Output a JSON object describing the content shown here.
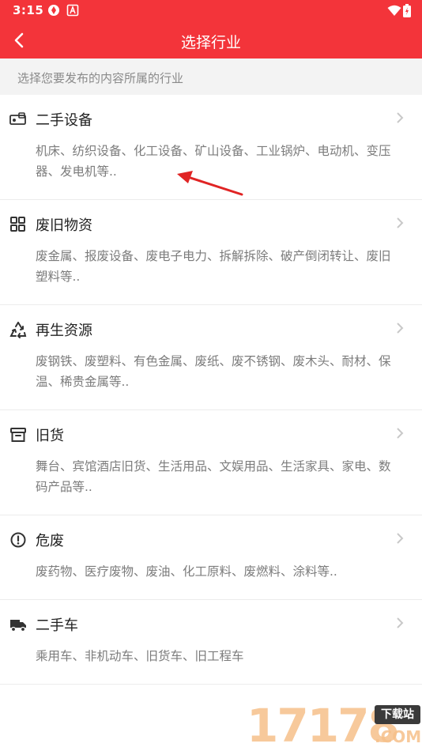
{
  "status_bar": {
    "time": "3:15",
    "icons": [
      "shield-icon",
      "a-box-icon",
      "wifi-icon",
      "battery-icon"
    ]
  },
  "app_bar": {
    "title": "选择行业",
    "back_icon": "chevron-left-icon"
  },
  "hint": "选择您要发布的内容所属的行业",
  "categories": [
    {
      "title": "二手设备",
      "icon": "equipment-icon",
      "desc": "机床、纺织设备、化工设备、矿山设备、工业锅炉、电动机、变压器、发电机等.."
    },
    {
      "title": "废旧物资",
      "icon": "grid-icon",
      "desc": "废金属、报废设备、废电子电力、拆解拆除、破产倒闭转让、废旧塑料等.."
    },
    {
      "title": "再生资源",
      "icon": "recycle-icon",
      "desc": "废钢铁、废塑料、有色金属、废纸、废不锈钢、废木头、耐材、保温、稀贵金属等.."
    },
    {
      "title": "旧货",
      "icon": "archive-icon",
      "desc": "舞台、宾馆酒店旧货、生活用品、文娱用品、生活家具、家电、数码产品等.."
    },
    {
      "title": "危废",
      "icon": "alert-circle-icon",
      "desc": "废药物、医疗废物、废油、化工原料、废燃料、涂料等.."
    },
    {
      "title": "二手车",
      "icon": "truck-icon",
      "desc": "乘用车、非机动车、旧货车、旧工程车"
    }
  ],
  "colors": {
    "header_bg": "#f3343a",
    "hint_bg": "#f3f3f3",
    "annotation_arrow": "#e02424"
  },
  "watermark": {
    "digits": "17178",
    "badge": "下载站",
    "suffix": ".COM"
  }
}
